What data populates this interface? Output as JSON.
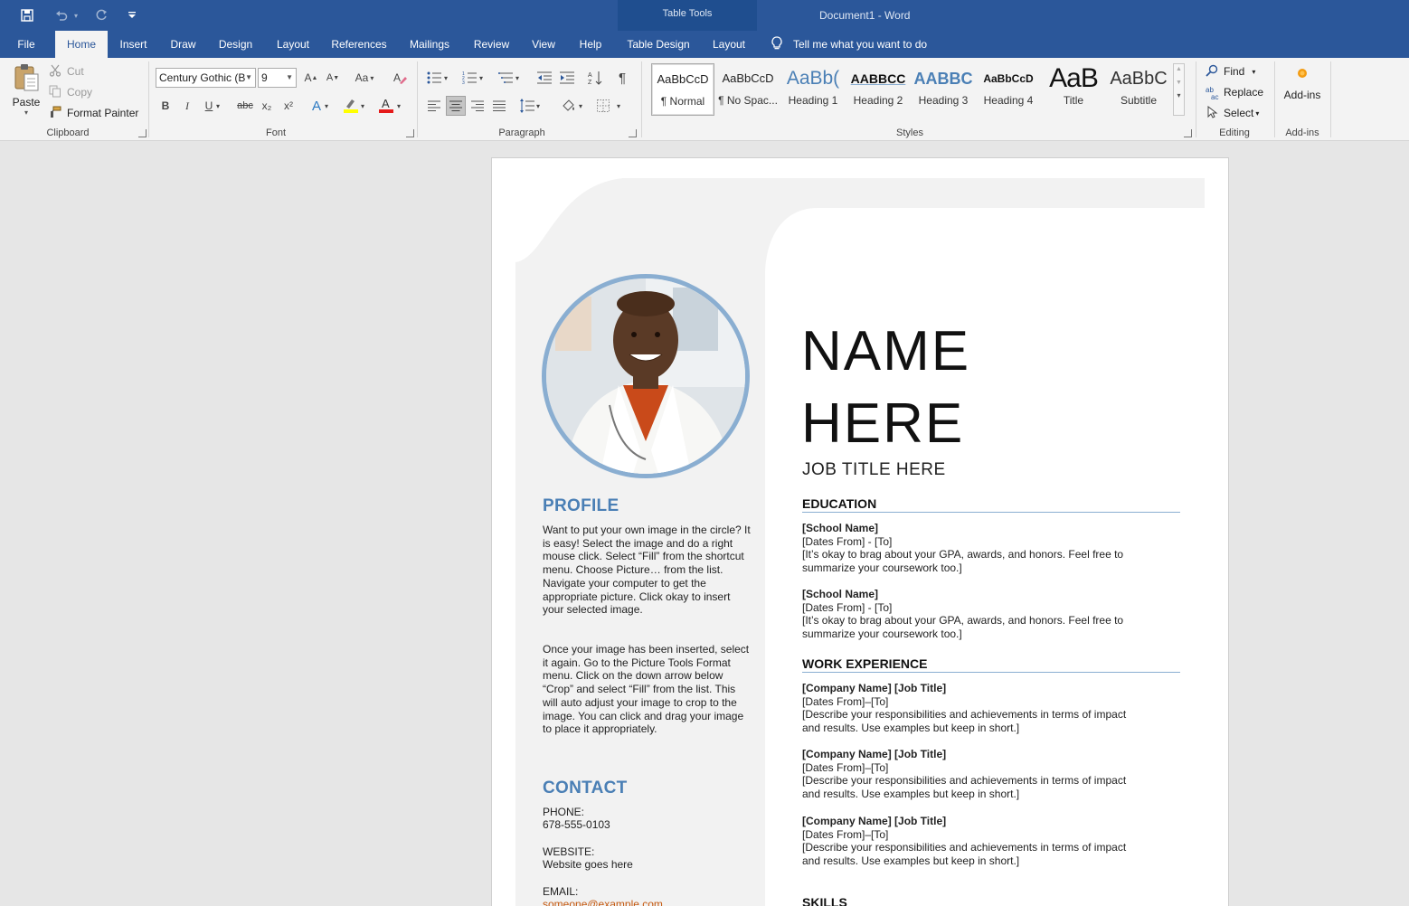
{
  "app": {
    "doc_title": "Document1  -  Word",
    "contextual_group": "Table Tools"
  },
  "qat": [
    "save-icon",
    "undo-icon",
    "redo-icon",
    "customize-qat-icon"
  ],
  "tabs": [
    {
      "label": "File"
    },
    {
      "label": "Home"
    },
    {
      "label": "Insert"
    },
    {
      "label": "Draw"
    },
    {
      "label": "Design"
    },
    {
      "label": "Layout"
    },
    {
      "label": "References"
    },
    {
      "label": "Mailings"
    },
    {
      "label": "Review"
    },
    {
      "label": "View"
    },
    {
      "label": "Help"
    },
    {
      "label": "Table Design"
    },
    {
      "label": "Layout"
    }
  ],
  "tell_me": "Tell me what you want to do",
  "ribbon": {
    "clipboard": {
      "label": "Clipboard",
      "paste": "Paste",
      "cut": "Cut",
      "copy": "Copy",
      "format_painter": "Format Painter"
    },
    "font": {
      "label": "Font",
      "font_name": "Century Gothic (B",
      "font_size": "9",
      "bold": "B",
      "italic": "I",
      "underline": "U",
      "strike": "abc",
      "subscript": "x₂",
      "superscript": "x²",
      "change_case": "Aa"
    },
    "paragraph": {
      "label": "Paragraph"
    },
    "styles": {
      "label": "Styles",
      "items": [
        {
          "sample": "AaBbCcD",
          "name": "¶ Normal"
        },
        {
          "sample": "AaBbCcD",
          "name": "¶ No Spac..."
        },
        {
          "sample": "AaBb(",
          "name": "Heading 1"
        },
        {
          "sample": "AABBCC",
          "name": "Heading 2"
        },
        {
          "sample": "AABBC",
          "name": "Heading 3"
        },
        {
          "sample": "AaBbCcD",
          "name": "Heading 4"
        },
        {
          "sample": "AaB",
          "name": "Title"
        },
        {
          "sample": "AaBbC",
          "name": "Subtitle"
        }
      ]
    },
    "editing": {
      "label": "Editing",
      "find": "Find",
      "replace": "Replace",
      "select": "Select"
    },
    "addins": {
      "label": "Add-ins",
      "button": "Add-ins"
    }
  },
  "document": {
    "name_line1": "NAME",
    "name_line2": "HERE",
    "job_title": "JOB TITLE HERE",
    "profile_heading": "PROFILE",
    "profile_p1": "Want to put your own image in the circle?  It is easy!  Select the image and do a right mouse click.  Select “Fill” from the shortcut menu.  Choose Picture… from the list.  Navigate your computer to get the appropriate picture.  Click okay to insert your selected image.",
    "profile_p2": "Once your image has been inserted, select it again.  Go to the Picture Tools Format menu. Click on the down arrow below “Crop” and select “Fill” from the list.  This will auto adjust your image to crop to the image.  You can click and drag your image to place it appropriately.",
    "contact_heading": "CONTACT",
    "phone_label": "PHONE:",
    "phone": "678-555-0103",
    "website_label": "WEBSITE:",
    "website": "Website goes here",
    "email_label": "EMAIL:",
    "email": "someone@example.com",
    "education_heading": "EDUCATION",
    "education": [
      {
        "school": "[School Name]",
        "dates": "[Dates From] - [To]",
        "desc1": "[It’s okay to brag about your GPA, awards, and honors. Feel free to",
        "desc2": "summarize your coursework too.]"
      },
      {
        "school": "[School Name]",
        "dates": "[Dates From] - [To]",
        "desc1": "[It’s okay to brag about your GPA, awards, and honors. Feel free to",
        "desc2": "summarize your coursework too.]"
      }
    ],
    "work_heading": "WORK EXPERIENCE",
    "work": [
      {
        "title": "[Company Name]  [Job Title]",
        "dates": "[Dates From]–[To]",
        "desc1": "[Describe your responsibilities and achievements in terms of impact",
        "desc2": "and results. Use examples but keep in short.]"
      },
      {
        "title": "[Company Name]  [Job Title]",
        "dates": "[Dates From]–[To]",
        "desc1": "[Describe your responsibilities and achievements in terms of impact",
        "desc2": "and results. Use examples but keep in short.]"
      },
      {
        "title": "[Company Name]  [Job Title]",
        "dates": "[Dates From]–[To]",
        "desc1": "[Describe your responsibilities and achievements in terms of impact",
        "desc2": "and results. Use examples but keep in short.]"
      }
    ],
    "skills_heading": "SKILLS"
  },
  "colors": {
    "title_bar": "#2b579a",
    "accent_blue": "#4a7fb5",
    "photo_ring": "#8aaed1",
    "email_link": "#c55a11",
    "sidebar_fill": "#f2f2f2"
  }
}
